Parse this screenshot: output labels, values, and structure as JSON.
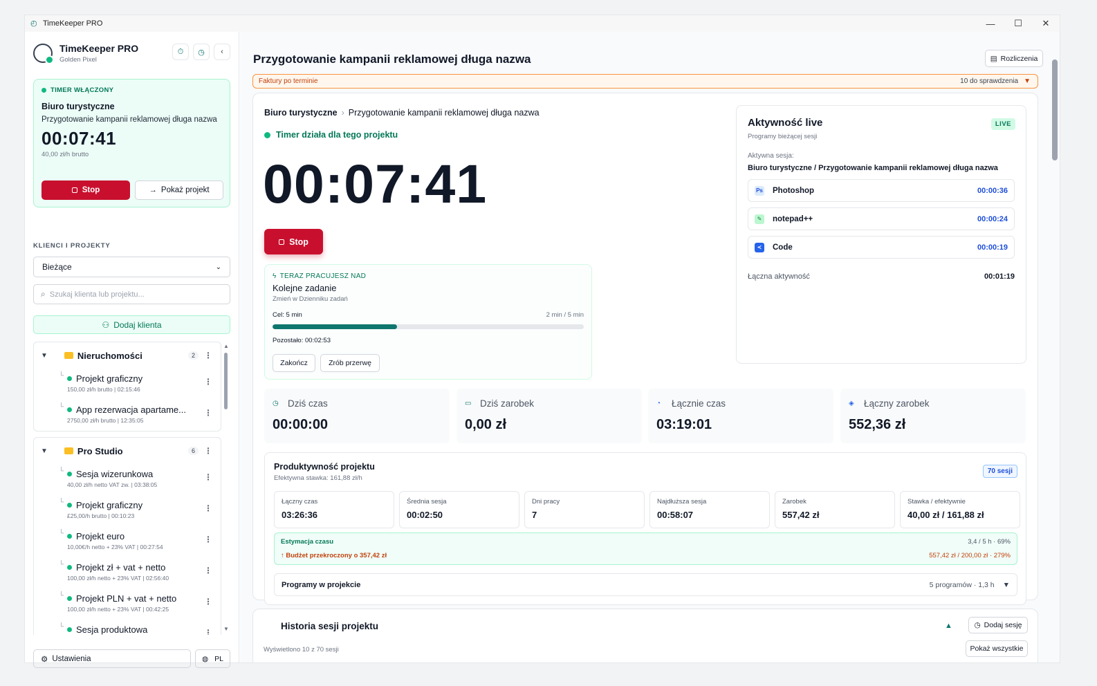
{
  "window": {
    "title": "TimeKeeper PRO"
  },
  "brand": {
    "name": "TimeKeeper PRO",
    "sub": "Golden Pixel"
  },
  "timer_card": {
    "status": "TIMER WŁĄCZONY",
    "client": "Biuro turystyczne",
    "project": "Przygotowanie kampanii reklamowej długa nazwa",
    "time": "00:07:41",
    "rate": "40,00 zł/h brutto",
    "stop_label": "Stop",
    "show_label": "Pokaż projekt"
  },
  "sidebar": {
    "section_label": "KLIENCI I PROJEKTY",
    "filter_value": "Bieżące",
    "search_placeholder": "Szukaj klienta lub projektu...",
    "add_client_label": "Dodaj klienta",
    "groups": [
      {
        "name": "Nieruchomości",
        "count": "2",
        "items": [
          {
            "name": "Projekt graficzny",
            "meta": "150,00 zł/h brutto | 02:15:46"
          },
          {
            "name": "App rezerwacja apartame...",
            "meta": "2750,00 zł/h brutto | 12:35:05"
          }
        ]
      },
      {
        "name": "Pro Studio",
        "count": "6",
        "items": [
          {
            "name": "Sesja wizerunkowa",
            "meta": "40,00 zł/h netto VAT zw. | 03:38:05"
          },
          {
            "name": "Projekt graficzny",
            "meta": "£25,00/h brutto | 00:10:23"
          },
          {
            "name": "Projekt euro",
            "meta": "10,00€/h netto + 23% VAT | 00:27:54"
          },
          {
            "name": "Projekt zł + vat + netto",
            "meta": "100,00 zł/h netto + 23% VAT | 02:56:40"
          },
          {
            "name": "Projekt PLN + vat + netto",
            "meta": "100,00 zł/h netto + 23% VAT | 00:42:25"
          },
          {
            "name": "Sesja produktowa",
            "meta": ""
          }
        ]
      }
    ],
    "settings_label": "Ustawienia",
    "lang_label": "PL"
  },
  "main": {
    "title": "Przygotowanie kampanii reklamowej długa nazwa",
    "billing_label": "Rozliczenia",
    "alert": {
      "left": "Faktury po terminie",
      "right": "10 do sprawdzenia"
    },
    "breadcrumb": {
      "client": "Biuro turystyczne",
      "project": "Przygotowanie kampanii reklamowej długa nazwa"
    },
    "running_label": "Timer działa dla tego projektu",
    "big_time": "00:07:41",
    "stop_label": "Stop",
    "task": {
      "header": "TERAZ PRACUJESZ NAD",
      "name": "Kolejne zadanie",
      "sub": "Zmień w Dzienniku zadań",
      "goal": "Cel: 5 min",
      "goal_progress": "2 min / 5 min",
      "progress_fraction": 0.4,
      "remaining": "Pozostało: 00:02:53",
      "finish_label": "Zakończ",
      "break_label": "Zrób przerwę"
    },
    "live": {
      "title": "Aktywność live",
      "badge": "LIVE",
      "sub": "Programy bieżącej sesji",
      "active_label": "Aktywna sesja:",
      "active_value": "Biuro turystyczne / Przygotowanie kampanii reklamowej długa nazwa",
      "apps": [
        {
          "name": "Photoshop",
          "time": "00:00:36",
          "icon": "Ps"
        },
        {
          "name": "notepad++",
          "time": "00:00:24",
          "icon": ""
        },
        {
          "name": "Code",
          "time": "00:00:19",
          "icon": ""
        }
      ],
      "total_label": "Łączna aktywność",
      "total_value": "00:01:19"
    },
    "stats": [
      {
        "label": "Dziś czas",
        "value": "00:00:00",
        "icon": "clock-icon"
      },
      {
        "label": "Dziś zarobek",
        "value": "0,00 zł",
        "icon": "wallet-icon"
      },
      {
        "label": "Łącznie czas",
        "value": "03:19:01",
        "icon": "history-icon"
      },
      {
        "label": "Łączny zarobek",
        "value": "552,36 zł",
        "icon": "money-icon"
      }
    ],
    "productivity": {
      "title": "Produktywność projektu",
      "sub": "Efektywna stawka: 161,88 zł/h",
      "sessions_badge": "70 sesji",
      "metrics": [
        {
          "label": "Łączny czas",
          "value": "03:26:36"
        },
        {
          "label": "Średnia sesja",
          "value": "00:02:50"
        },
        {
          "label": "Dni pracy",
          "value": "7"
        },
        {
          "label": "Najdłuższa sesja",
          "value": "00:58:07"
        },
        {
          "label": "Zarobek",
          "value": "557,42 zł"
        },
        {
          "label": "Stawka / efektywnie",
          "value": "40,00 zł / 161,88 zł"
        }
      ],
      "estimation": {
        "title": "Estymacja czasu",
        "time_ratio": "3,4 / 5 h · 69%",
        "over_budget": "↑ Budżet przekroczony o 357,42 zł",
        "budget_ratio": "557,42 zł / 200,00 zł · 279%"
      },
      "programs_label": "Programy w projekcie",
      "programs_summary": "5 programów · 1,3 h"
    },
    "history": {
      "title": "Historia sesji projektu",
      "sub": "Wyświetlono 10 z 70 sesji",
      "add_label": "Dodaj sesję",
      "show_all_label": "Pokaż wszystkie"
    }
  }
}
